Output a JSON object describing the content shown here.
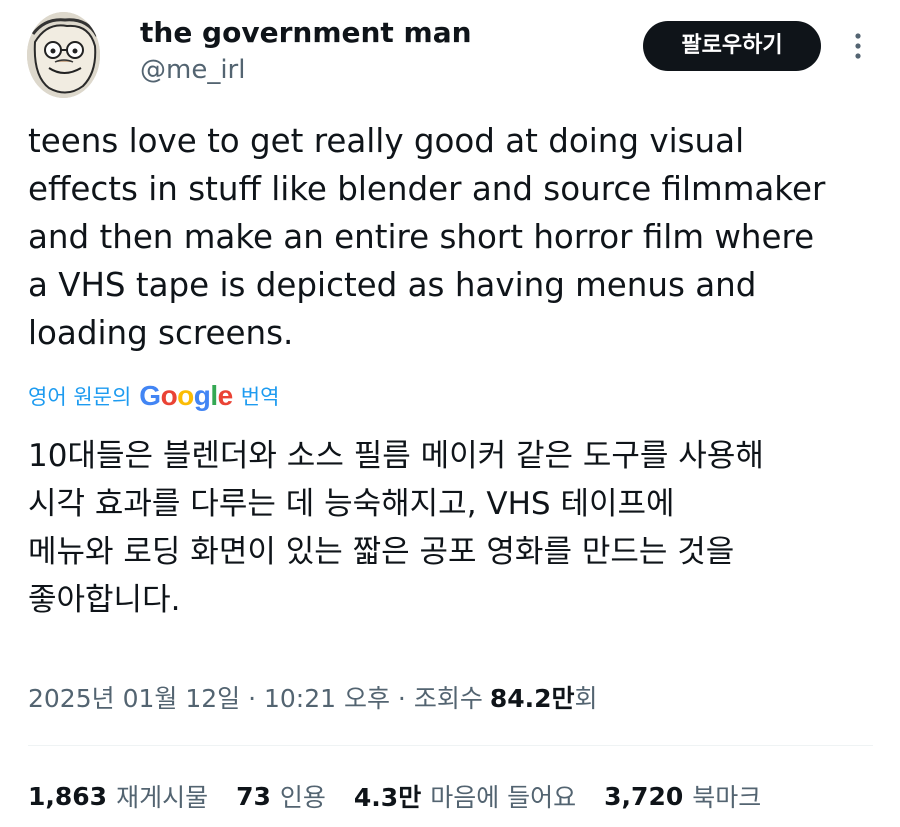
{
  "author": {
    "display_name": "the government man",
    "handle": "@me_irl"
  },
  "follow_button": {
    "label": "팔로우하기"
  },
  "icons": {
    "avatar": "avatar-image",
    "more": "more-options-icon"
  },
  "tweet": {
    "text": "teens love to get really good at doing visual\neffects in stuff like blender and source filmmaker\nand then make an entire short horror film where\na VHS tape is depicted as having menus and\nloading screens."
  },
  "translation": {
    "lead": "영어 원문의",
    "provider": "Google",
    "action": "번역",
    "text": "10대들은 블렌더와 소스 필름 메이커 같은 도구를 사용해\n시각 효과를 다루는 데 능숙해지고, VHS 테이프에\n메뉴와 로딩 화면이 있는 짧은 공포 영화를 만드는 것을\n좋아합니다."
  },
  "meta": {
    "timestamp": "2025년 01월 12일 · 10:21 오후 · 조회수",
    "views_value": "84.2만",
    "views_suffix": "회"
  },
  "stats": [
    {
      "value": "1,863",
      "label": "재게시물"
    },
    {
      "value": "73",
      "label": "인용"
    },
    {
      "value": "4.3만",
      "label": "마음에 들어요"
    },
    {
      "value": "3,720",
      "label": "북마크"
    }
  ],
  "colors": {
    "text": "#0f1419",
    "secondary": "#536471",
    "link": "#1d9bf0",
    "button_bg": "#0f1419",
    "button_text": "#ffffff"
  }
}
